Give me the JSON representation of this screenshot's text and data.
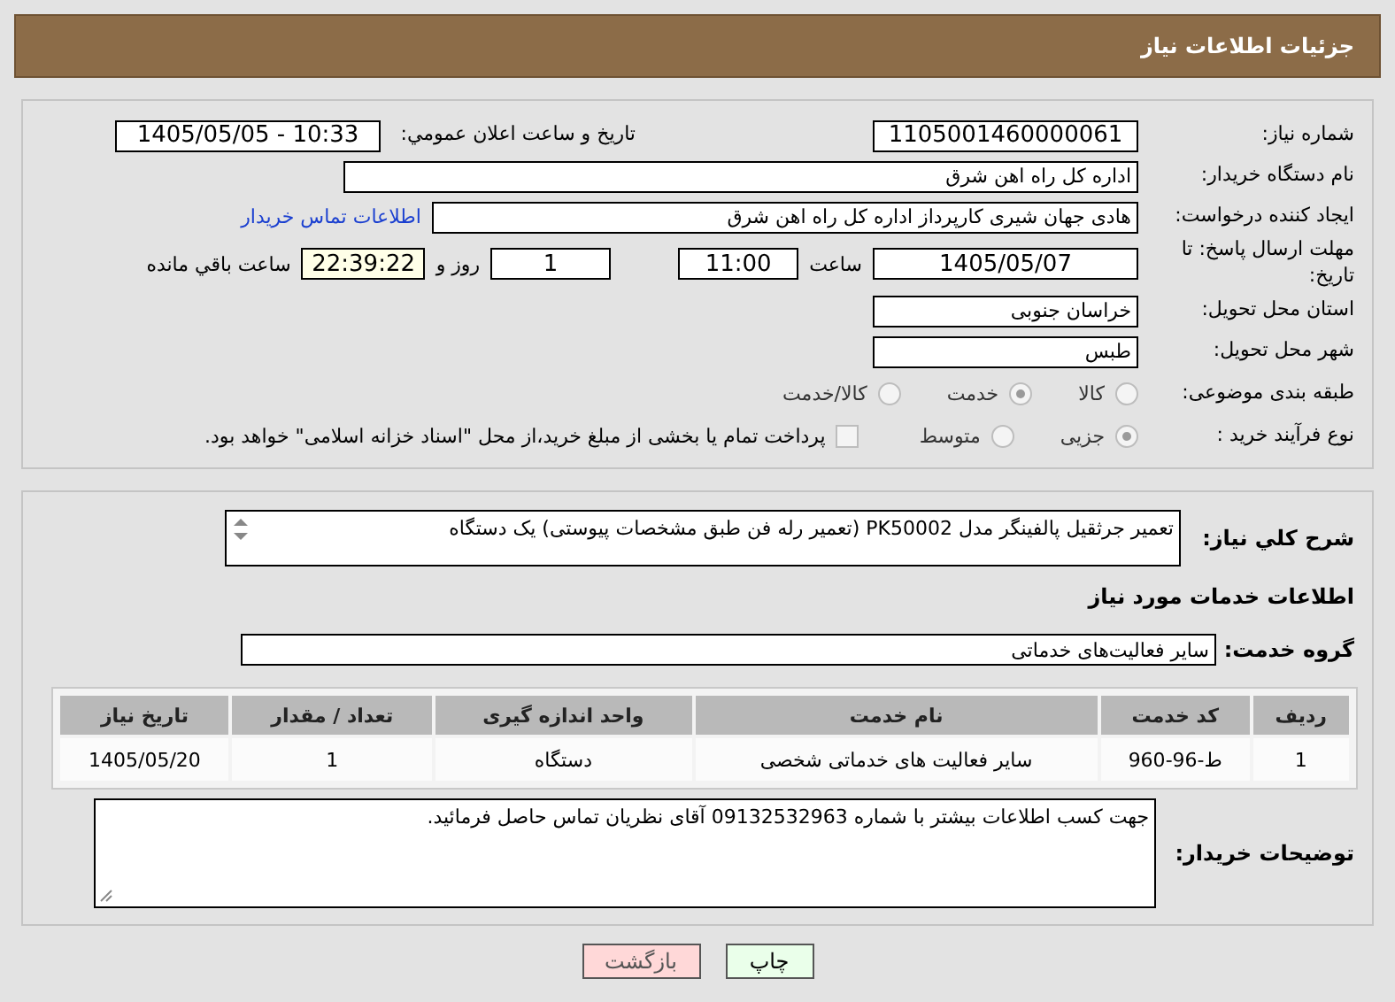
{
  "header": {
    "title": "جزئیات اطلاعات نیاز"
  },
  "need_number": {
    "label": "شماره نیاز:",
    "value": "1105001460000061"
  },
  "announce": {
    "label": "تاریخ و ساعت اعلان عمومي:",
    "value": "1405/05/05 - 10:33"
  },
  "buyer_org": {
    "label": "نام دستگاه خریدار:",
    "value": "اداره کل راه اهن شرق"
  },
  "requester": {
    "label": "ایجاد کننده درخواست:",
    "value": "هادی جهان شیری کارپرداز اداره کل راه اهن شرق",
    "link": "اطلاعات تماس خریدار"
  },
  "deadline": {
    "label": "مهلت ارسال پاسخ: تا تاریخ:",
    "date": "1405/05/07",
    "time_label": "ساعت",
    "time": "11:00",
    "days": "1",
    "days_label": "روز و",
    "remaining": "22:39:22",
    "remaining_label": "ساعت باقي مانده"
  },
  "province": {
    "label": "استان محل تحویل:",
    "value": "خراسان جنوبی"
  },
  "city": {
    "label": "شهر محل تحویل:",
    "value": "طبس"
  },
  "category": {
    "label": "طبقه بندی موضوعی:",
    "options": [
      {
        "label": "کالا",
        "selected": false
      },
      {
        "label": "خدمت",
        "selected": true
      },
      {
        "label": "کالا/خدمت",
        "selected": false
      }
    ]
  },
  "purchase_type": {
    "label": "نوع فرآیند خرید :",
    "options": [
      {
        "label": "جزیی",
        "selected": true
      },
      {
        "label": "متوسط",
        "selected": false
      }
    ],
    "treasury": {
      "checked": false,
      "text": "پرداخت تمام یا بخشی از مبلغ خرید،از محل \"اسناد خزانه اسلامی\" خواهد بود."
    }
  },
  "description": {
    "label": "شرح کلي نیاز:",
    "value": "تعمیر جرثقیل پالفینگر مدل PK50002 (تعمیر رله فن طبق مشخصات پیوستی)  یک دستگاه"
  },
  "services_heading": "اطلاعات خدمات مورد نیاز",
  "service_group": {
    "label": "گروه خدمت:",
    "value": "سایر فعالیت‌های خدماتی"
  },
  "table": {
    "columns": [
      "ردیف",
      "کد خدمت",
      "نام خدمت",
      "واحد اندازه گیری",
      "تعداد / مقدار",
      "تاریخ نیاز"
    ],
    "rows": [
      [
        "1",
        "ط-96-960",
        "سایر فعالیت های خدماتی شخصی",
        "دستگاه",
        "1",
        "1405/05/20"
      ]
    ]
  },
  "buyer_notes": {
    "label": "توضیحات خریدار:",
    "value": "جهت کسب اطلاعات بیشتر با شماره 09132532963  آقای نظریان  تماس حاصل فرمائید."
  },
  "buttons": [
    {
      "label": "چاپ",
      "kind": "print"
    },
    {
      "label": "بازگشت",
      "kind": "back"
    }
  ]
}
